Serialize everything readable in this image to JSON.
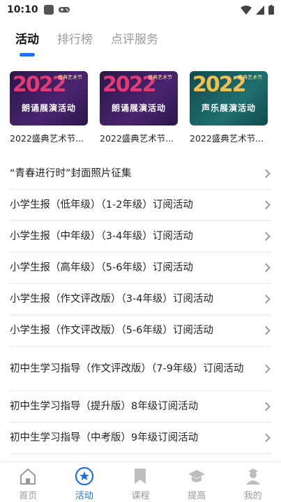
{
  "status_bar": {
    "time": "10:10"
  },
  "tabs": [
    {
      "label": "活动",
      "active": true
    },
    {
      "label": "排行榜",
      "active": false
    },
    {
      "label": "点评服务",
      "active": false
    }
  ],
  "cards": [
    {
      "label": "2022盛典艺术节...",
      "title": "朗诵展演活动",
      "year": "2022",
      "brand": "盛典艺术节",
      "theme": "purple"
    },
    {
      "label": "2022盛典艺术节...",
      "title": "朗诵展演活动",
      "year": "2022",
      "brand": "盛典艺术节",
      "theme": "purple"
    },
    {
      "label": "2022盛典艺术节...",
      "title": "声乐展演活动",
      "year": "2022",
      "brand": "盛典艺术节",
      "theme": "teal"
    }
  ],
  "list": [
    "“青春进行时”封面照片征集",
    "小学生报（低年级）（1-2年级）订阅活动",
    "小学生报（中年级）（3-4年级）订阅活动",
    "小学生报（高年级）（5-6年级）订阅活动",
    "小学生报（作文评改版）（3-4年级）订阅活动",
    "小学生报（作文评改版）（5-6年级）订阅活动",
    "初中生学习指导（作文评改版）（7-9年级）订阅活动",
    "初中生学习指导（提升版）8年级订阅活动",
    "初中生学习指导（中考版）9年级订阅活动"
  ],
  "bottom_nav": [
    {
      "label": "首页",
      "icon": "home-icon",
      "active": false
    },
    {
      "label": "活动",
      "icon": "star-icon",
      "active": true
    },
    {
      "label": "课程",
      "icon": "bookmark-icon",
      "active": false
    },
    {
      "label": "提高",
      "icon": "graduation-cap-icon",
      "active": false
    },
    {
      "label": "我的",
      "icon": "user-icon",
      "active": false
    }
  ],
  "colors": {
    "accent": "#1d6ff2",
    "inactive": "#9a9a9a",
    "card_purple": "#3a1f5c",
    "card_teal": "#1f6f6f"
  }
}
